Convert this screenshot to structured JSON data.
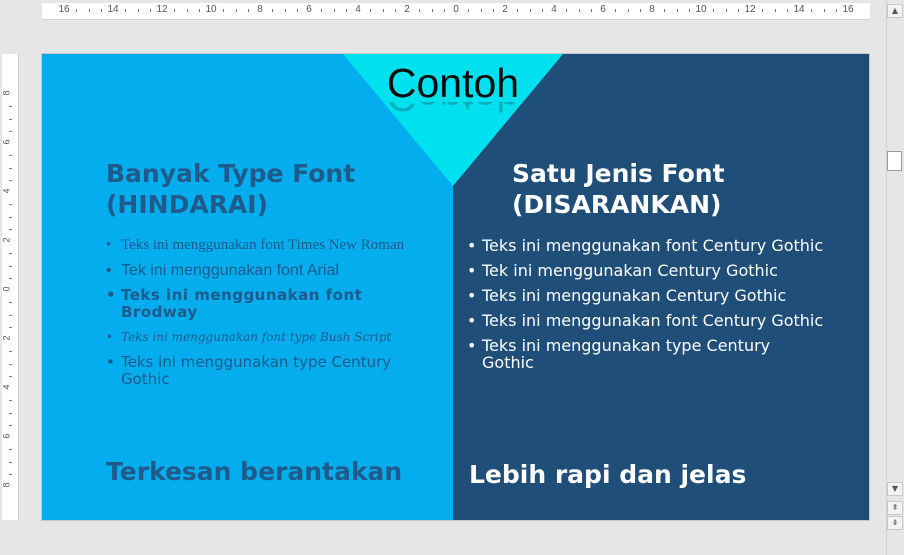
{
  "ruler": {
    "horizontal_labels": [
      "16",
      "14",
      "12",
      "10",
      "8",
      "6",
      "4",
      "2",
      "0",
      "2",
      "4",
      "6",
      "8",
      "10",
      "12",
      "14",
      "16"
    ],
    "vertical_labels": [
      "8",
      "6",
      "4",
      "2",
      "0",
      "2",
      "4",
      "6",
      "8"
    ]
  },
  "slide": {
    "title": "Contoh",
    "left": {
      "heading_line1": "Banyak Type Font",
      "heading_line2": "(HINDARAI)",
      "bullets": [
        "Teks ini menggunakan font Times New Roman",
        "Tek ini menggunakan font Arial",
        "Teks ini menggunakan font Brodway",
        "Teks ini menggunakan font type Bush Script",
        "Teks ini menggunakan type Century Gothic"
      ],
      "footer": "Terkesan berantakan"
    },
    "right": {
      "heading_line1": "Satu Jenis Font",
      "heading_line2": "(DISARANKAN)",
      "bullets": [
        "Teks ini menggunakan font Century Gothic",
        "Tek ini menggunakan Century Gothic",
        "Teks ini menggunakan Century Gothic",
        "Teks ini menggunakan font Century Gothic",
        "Teks ini menggunakan type Century Gothic"
      ],
      "footer": "Lebih rapi dan jelas"
    }
  },
  "colors": {
    "left_bg": "#03adee",
    "right_bg": "#1f4e79",
    "triangle": "#00e1ef",
    "left_text": "#1f5a8b",
    "right_text": "#ffffff"
  },
  "icons": {
    "bullet": "•",
    "scroll_up": "▲",
    "scroll_down": "▼",
    "prev_slide": "⇞",
    "next_slide": "⇟"
  }
}
